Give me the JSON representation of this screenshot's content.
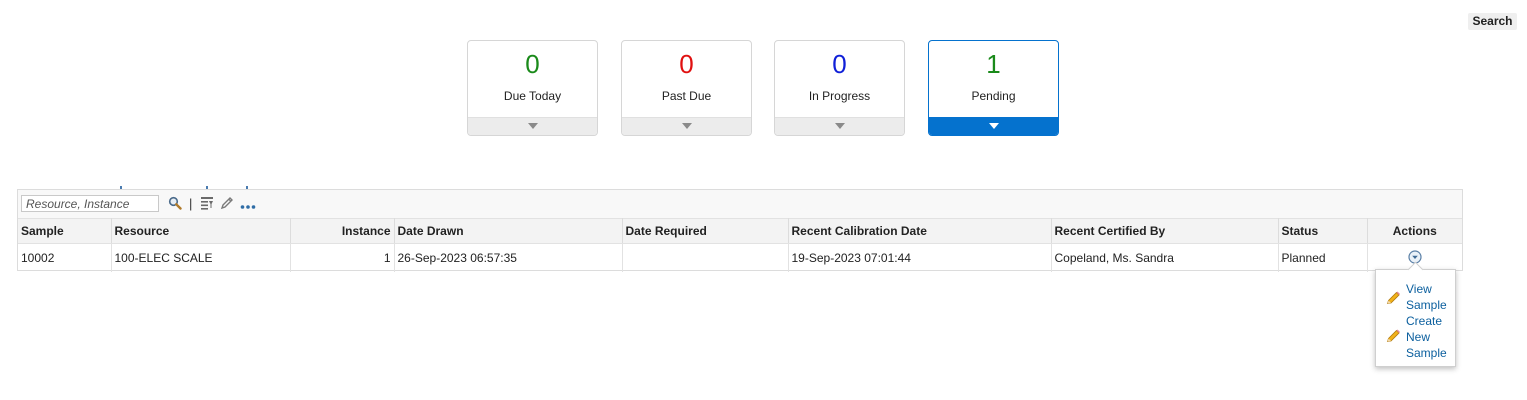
{
  "header": {
    "search_label": "Search"
  },
  "tiles": [
    {
      "count": "0",
      "label": "Due Today",
      "color": "#1a8a1a",
      "selected": false
    },
    {
      "count": "0",
      "label": "Past Due",
      "color": "#e01010",
      "selected": false
    },
    {
      "count": "0",
      "label": "In Progress",
      "color": "#1020d8",
      "selected": false
    },
    {
      "count": "1",
      "label": "Pending",
      "color": "#1a8a1a",
      "selected": true
    }
  ],
  "filter": {
    "placeholder": "Resource, Instance",
    "value": ""
  },
  "toolbar": {
    "icons": [
      "search-icon",
      "filter-list-icon",
      "edit-pencil-icon",
      "more-options-icon"
    ],
    "separator": "|"
  },
  "table": {
    "columns": [
      "Sample",
      "Resource",
      "Instance",
      "Date Drawn",
      "Date Required",
      "Recent Calibration Date",
      "Recent Certified By",
      "Status",
      "Actions"
    ],
    "rows": [
      {
        "sample": "10002",
        "resource": "100-ELEC SCALE",
        "instance": "1",
        "date_drawn": "26-Sep-2023 06:57:35",
        "date_required": "",
        "recent_calibration_date": "19-Sep-2023 07:01:44",
        "recent_certified_by": "Copeland, Ms. Sandra",
        "status": "Planned",
        "actions_icon": "chevron-down-circle-icon"
      }
    ]
  },
  "actions_menu": {
    "items": [
      {
        "label_1": "View",
        "label_2": "Sample",
        "icon": "pencil-icon"
      },
      {
        "label_1": "Create",
        "label_2": "New",
        "label_3": "Sample",
        "icon": "pencil-icon"
      }
    ]
  },
  "colors": {
    "accent": "#0572ce",
    "link": "#0b5f9e"
  }
}
